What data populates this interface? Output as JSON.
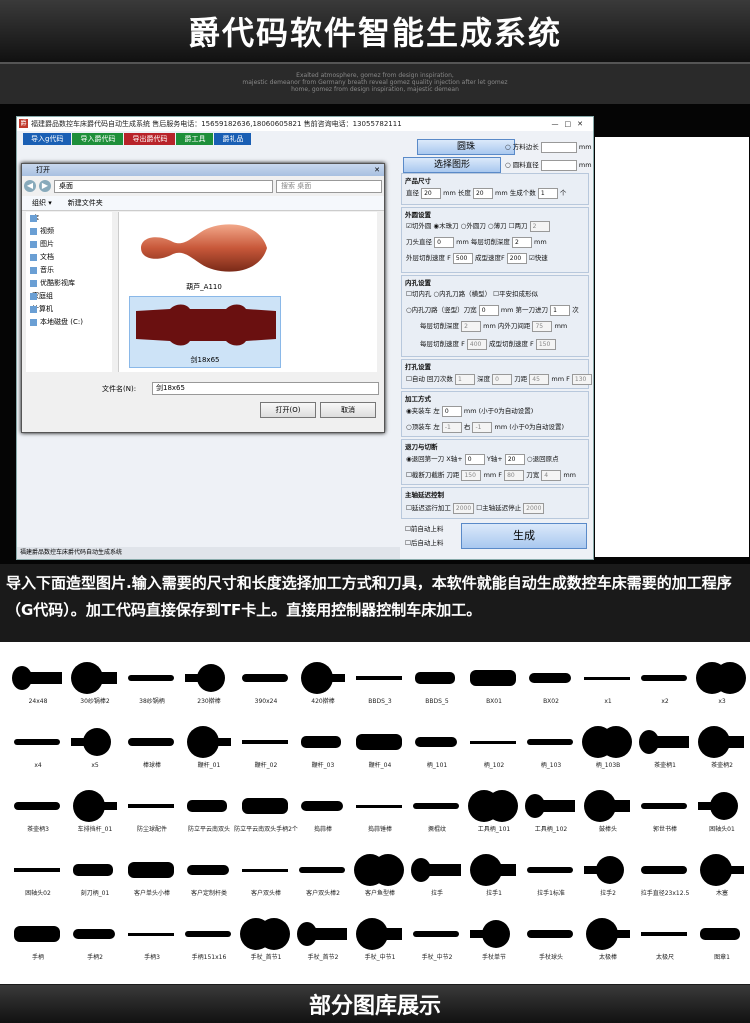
{
  "header": {
    "title": "爵代码软件智能生成系统"
  },
  "decoration": {
    "lines": [
      "Exalted atmosphere, gomez from design inspiration,",
      "majestic demeanor from Germany breath reveal gomez quality injection after let gomez",
      "home, gomez from design inspiration, majestic demean"
    ]
  },
  "app": {
    "title": "福建爵品数控车床爵代码自动生成系统  售后服务电话：15659182636,18060605821  售前咨询电话：13055782111",
    "window_controls": [
      "—",
      "□",
      "✕"
    ],
    "menu": [
      {
        "label": "导入g代码",
        "color": "#1a5fb4"
      },
      {
        "label": "导入爵代码",
        "color": "#1e8f3a"
      },
      {
        "label": "导出爵代码",
        "color": "#b8232a"
      },
      {
        "label": "爵工具",
        "color": "#1e8f3a"
      },
      {
        "label": "爵礼品",
        "color": "#1a5fb4"
      }
    ],
    "status": "福建爵品数控车床爵代码自动生成系统"
  },
  "dialog": {
    "title": "打开",
    "address": "桌面",
    "search_placeholder": "搜索 桌面",
    "toolbar": [
      "组织 ▾",
      "新建文件夹"
    ],
    "sidebar": [
      {
        "label": "库",
        "group": true
      },
      {
        "label": "视频"
      },
      {
        "label": "图片"
      },
      {
        "label": "文档"
      },
      {
        "label": "音乐"
      },
      {
        "label": "优酷影视库"
      },
      {
        "label": "家庭组",
        "group": true
      },
      {
        "label": "计算机",
        "group": true
      },
      {
        "label": "本地磁盘 (C:)"
      }
    ],
    "files": [
      {
        "name": "葫芦_A110"
      },
      {
        "name": "剑18x65"
      }
    ],
    "filename_label": "文件名(N):",
    "filename_value": "剑18x65",
    "open_button": "打开(O)",
    "cancel_button": "取消"
  },
  "panel": {
    "round_bead": "圆珠",
    "select_shape": "选择图形",
    "square_side": "方料边长",
    "round_diameter": "圆料直径",
    "mm": "mm",
    "size": {
      "title": "产品尺寸",
      "diameter_label": "直径",
      "diameter": "20",
      "length_label": "长度",
      "length": "20",
      "count_label": "生成个数",
      "count": "1",
      "count_unit": "个"
    },
    "outer": {
      "title": "外圆设置",
      "opts": [
        "切外圆",
        "木珠刀",
        "外圆刀",
        "薄刀",
        "两刀"
      ],
      "two_val": "2",
      "tool_dia_label": "刀头直径",
      "tool_dia": "0",
      "cut_depth_label": "每层切削深度",
      "cut_depth": "2",
      "speed_label": "外层切削速度 F",
      "speed": "500",
      "form_speed_label": "成型速度F",
      "form_speed": "200",
      "fast": "快速"
    },
    "inner": {
      "title": "内孔设置",
      "opts": [
        "切内孔",
        "内孔刀路（横型）",
        "平安扣成形似"
      ],
      "line2": "内孔刀路（竖型）刀宽",
      "knife_w": "0",
      "first_label": "mm 第一刀进刀",
      "first": "1",
      "times": "次",
      "depth_label": "每层切削深度",
      "depth": "2",
      "mm": "mm",
      "inner_dia_label": "内外刀间距",
      "inner_dia": "75",
      "speed_label": "每层切削速度 F",
      "speed": "400",
      "form_label": "成型切削速度 F",
      "form": "150"
    },
    "drill": {
      "title": "打孔设置",
      "auto": "自动",
      "back_label": "回刀次数",
      "back": "1",
      "depth_label": "深度",
      "depth": "0",
      "knife_label": "刀距",
      "knife": "45",
      "f_label": "mm F",
      "f": "130"
    },
    "method": {
      "title": "加工方式",
      "chuck": "夹装车",
      "left_label": "左",
      "left": "0",
      "chuck_note": "(小于0为自动设置)",
      "top": "顶装车",
      "top_left": "-1",
      "right_label": "右",
      "right": "-1",
      "top_note": "(小于0为自动设置)"
    },
    "retract": {
      "title": "退刀与切断",
      "first": "退回第一刀",
      "x_label": "X轴+",
      "x": "0",
      "y_label": "Y轴+",
      "y": "20",
      "origin": "退回原点",
      "cutoff": "截断刀截断",
      "blade_label": "刀距",
      "blade": "150",
      "f_label": "mm F",
      "f": "80",
      "width_label": "刀宽",
      "width": "4"
    },
    "spindle": {
      "title": "主轴延迟控制",
      "delay_run": "延迟运行加工",
      "delay_run_val": "2000",
      "delay_stop": "主轴延迟停止",
      "delay_stop_val": "2000"
    },
    "front_feed": "前自动上料",
    "back_feed": "后自动上料",
    "generate": "生成"
  },
  "description": "导入下面造型图片.输入需要的尺寸和长度选择加工方式和刀具，本软件就能自动生成数控车床需要的加工程序（G代码）。加工代码直接保存到TF卡上。直接用控制器控制车床加工。",
  "library": {
    "items": [
      "24x48",
      "30纱锅棒2",
      "38纱锅柄",
      "230擀棒",
      "390x24",
      "420擀棒",
      "BBDS_3",
      "BBDS_5",
      "BX01",
      "BX02",
      "x1",
      "x2",
      "x3",
      "x4",
      "x5",
      "棒球棒",
      "鞭杆_01",
      "鞭杆_02",
      "鞭杆_03",
      "鞭杆_04",
      "柄_101",
      "柄_102",
      "柄_103",
      "柄_103B",
      "茶壶柄1",
      "茶壶柄2",
      "茶壶柄3",
      "车排挡杆_01",
      "防尘球配件",
      "防立平云南双头",
      "防立平云南双头手柄2个",
      "捣蒜棒",
      "捣蒜锤棒",
      "撅棍纹",
      "工具柄_101",
      "工具柄_102",
      "鼓棒头",
      "郭世书棒",
      "困轴头01",
      "困轴头02",
      "刻刀柄_01",
      "客户单头小棒",
      "客户定制杆类",
      "客户双头棒",
      "客户双头棒2",
      "客户鱼型棒",
      "拉手",
      "拉手1",
      "拉手1标准",
      "拉手2",
      "拉手直径23x12.5",
      "木塞",
      "手柄",
      "手柄2",
      "手柄3",
      "手柄151x16",
      "手杖_首节1",
      "手杖_首节2",
      "手杖_中节1",
      "手杖_中节2",
      "手杖单节",
      "手杖球头",
      "太极棒",
      "太极尺",
      "图章1"
    ]
  },
  "footer": {
    "title": "部分图库展示"
  }
}
